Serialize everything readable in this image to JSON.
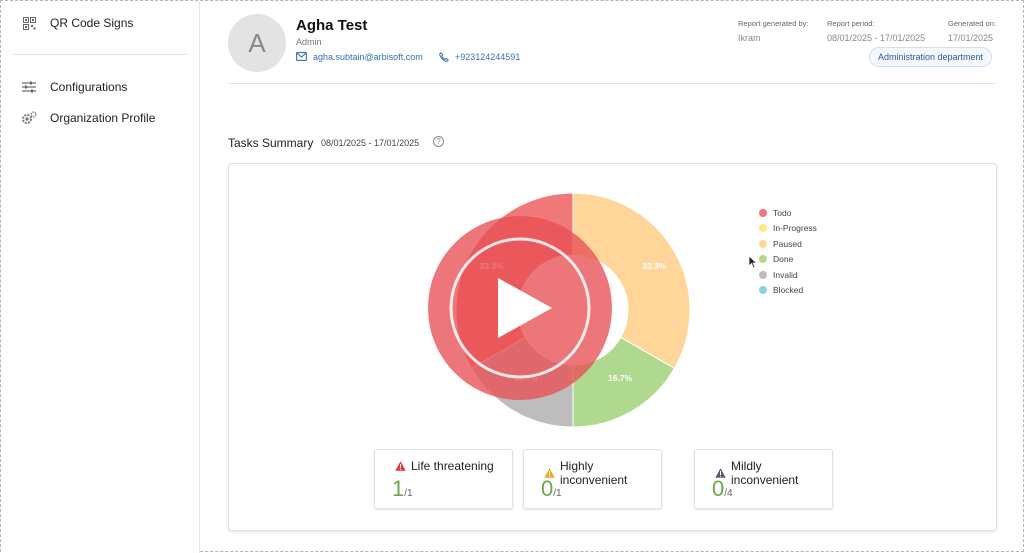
{
  "sidebar": {
    "items": [
      {
        "label": "QR Code Signs",
        "icon": "qr-code-icon"
      },
      {
        "label": "Configurations",
        "icon": "sliders-icon"
      },
      {
        "label": "Organization Profile",
        "icon": "gears-icon"
      }
    ]
  },
  "profile": {
    "avatar_letter": "A",
    "name": "Agha Test",
    "role": "Admin",
    "email": "agha.subtain@arbisoft.com",
    "phone": "+923124244591"
  },
  "report": {
    "generated_by_label": "Report generated by:",
    "generated_by": "Ikram",
    "period_label": "Report period:",
    "period": "08/01/2025 - 17/01/2025",
    "generated_on_label": "Generated on:",
    "generated_on": "17/01/2025",
    "department": "Administration department"
  },
  "summary": {
    "title": "Tasks Summary",
    "range": "08/01/2025 - 17/01/2025"
  },
  "chart_data": {
    "type": "pie",
    "style": "doughnut",
    "legend_position": "right",
    "categories": [
      "Todo",
      "In-Progress",
      "Paused",
      "Done",
      "Invalid",
      "Blocked"
    ],
    "values": [
      33.3,
      0,
      33.3,
      16.7,
      16.7,
      0
    ],
    "labels_shown": [
      "33.3%",
      "33.3%",
      "16.7%",
      "16.7%"
    ],
    "colors": {
      "Todo": "#f07878",
      "In-Progress": "#ffe680",
      "Paused": "#ffd59a",
      "Done": "#aed98f",
      "Invalid": "#bdbdbd",
      "Blocked": "#8ecfe0"
    }
  },
  "severity": [
    {
      "label": "Life threatening",
      "value": "1",
      "total": "/1",
      "color": "#e53935"
    },
    {
      "label": "Highly inconvenient",
      "value": "0",
      "total": "/1",
      "color": "#f5a623"
    },
    {
      "label": "Mildly inconvenient",
      "value": "0",
      "total": "/4",
      "color": "#555a6e"
    }
  ],
  "overlay": {
    "icon": "play-icon"
  }
}
